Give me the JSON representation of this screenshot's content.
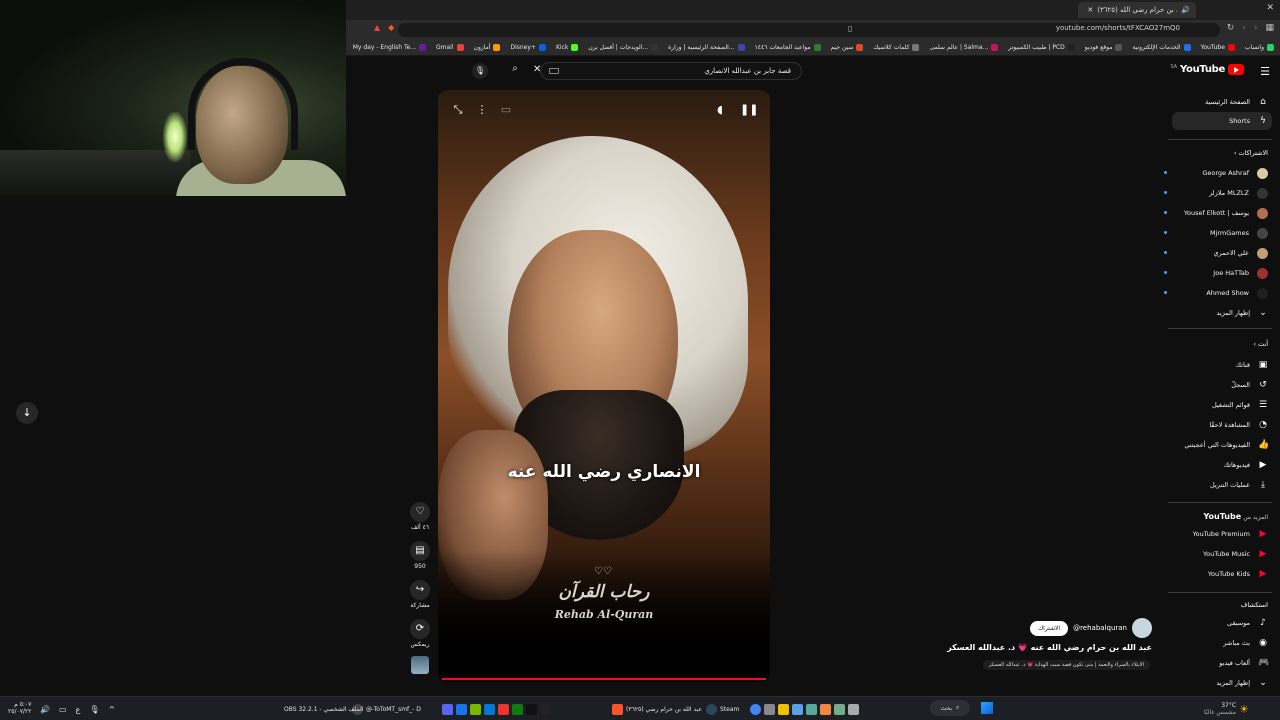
{
  "browser": {
    "tab_title": "(٣٦٢٥) عبد الله بن حرام رضي الله...",
    "url": "youtube.com/shorts/tFXCAO27mQ0",
    "bookmarks": [
      {
        "label": "واتساب",
        "color": "#25d366"
      },
      {
        "label": "YouTube",
        "color": "#ff0000"
      },
      {
        "label": "الخدمات الإلكترونية",
        "color": "#1a73e8"
      },
      {
        "label": "موقع فوديو",
        "color": "#555555"
      },
      {
        "label": "طبيب الكمبيوتر | PCD",
        "color": "#222222"
      },
      {
        "label": "عالم سلمى | Salma...",
        "color": "#c2185b"
      },
      {
        "label": "كلمات كلاسيك",
        "color": "#777777"
      },
      {
        "label": "سين جيم",
        "color": "#e64a19"
      },
      {
        "label": "مواعيد الجامعات ١٤٤٦",
        "color": "#2e7d32"
      },
      {
        "label": "الصفحة الرئيسية | وزارة...",
        "color": "#3949ab"
      },
      {
        "label": "الويدجات | أفضل برن...",
        "color": "#333333"
      },
      {
        "label": "Kick",
        "color": "#53fc18"
      },
      {
        "label": "Disney+",
        "color": "#0063e5"
      },
      {
        "label": "أمازون",
        "color": "#ff9900"
      },
      {
        "label": "Gmail",
        "color": "#ea4335"
      },
      {
        "label": "My day - English Te...",
        "color": "#6a1b9a"
      }
    ]
  },
  "youtube": {
    "logo": "YouTube",
    "country": "SA",
    "search_query": "قصة جابر بن عبدالله الانصاري"
  },
  "short": {
    "caption": "الانصاري رضي الله عنه",
    "watermark_ar": "رحاب القرآن",
    "watermark_en": "Rehab Al-Quran",
    "progress_fraction": 0.99,
    "likes": "٤٦ ألف",
    "comments": "950",
    "share": "مشاركة",
    "remix": "ريمكس",
    "channel_handle": "@rehabalquran",
    "subscribe": "الاشتراك",
    "title": "عبد الله بن حرام رضي الله عنه 💗 د. عبدالله العسكر",
    "subtitle": "الابتلاء بالسراء والنعمة | متى تكون قصة سبب الهداية 💗 د. عبدالله العسكر"
  },
  "sidebar": {
    "home": "الصفحة الرئيسية",
    "shorts": "Shorts",
    "subscriptions_head": "الاشتراكات",
    "subs": [
      {
        "name": "George Ashraf",
        "color": "#d9c9a8"
      },
      {
        "name": "ملازلز MLZLZ",
        "color": "#333333"
      },
      {
        "name": "Yousef Elkott | يوسف",
        "color": "#b07050"
      },
      {
        "name": "MjrmGames",
        "color": "#444444"
      },
      {
        "name": "علي الاحمري",
        "color": "#c2a070"
      },
      {
        "name": "Joe HaTTab",
        "color": "#a03030"
      },
      {
        "name": "Ahmed Show",
        "color": "#202020"
      }
    ],
    "show_more": "إظهار المزيد",
    "you_head": "أنت",
    "you_items": [
      {
        "label": "قناتك",
        "icon": "person-icon"
      },
      {
        "label": "السجلّ",
        "icon": "history-icon"
      },
      {
        "label": "قوائم التشغيل",
        "icon": "playlist-icon"
      },
      {
        "label": "المشاهدة لاحقًا",
        "icon": "clock-icon"
      },
      {
        "label": "الفيديوهات التي أعجبتني",
        "icon": "like-icon"
      },
      {
        "label": "فيديوهاتك",
        "icon": "video-icon"
      },
      {
        "label": "عمليات التنزيل",
        "icon": "download-icon"
      }
    ],
    "more_from_head": "المزيد من",
    "more_from_brand": "YouTube",
    "more_from": [
      {
        "label": "YouTube Premium"
      },
      {
        "label": "YouTube Music"
      },
      {
        "label": "YouTube Kids"
      }
    ],
    "explore_head": "استكشاف",
    "explore": [
      {
        "label": "موسيقى",
        "icon": "music-icon"
      },
      {
        "label": "بث مباشر",
        "icon": "live-icon"
      },
      {
        "label": "ألعاب فيديو",
        "icon": "game-icon"
      }
    ],
    "show_more_2": "إظهار المزيد"
  },
  "taskbar": {
    "search": "بحث",
    "items": [
      {
        "label": "OBS 32.2.1 - الملف الشخصي",
        "color": "#333333"
      },
      {
        "label": "@-ToToMT_smf_- D",
        "color": "#444444"
      },
      {
        "label": "(٣٦٢٥) عبد الله بن حرام رضي",
        "color": "#fb542b"
      },
      {
        "label": "Steam",
        "color": "#1b2838"
      }
    ],
    "weather": "37°C",
    "weather_desc": "مشمس غالبًا",
    "time": "٥:٠٧ م",
    "date": "٢٥/٠٧/٢٢"
  }
}
